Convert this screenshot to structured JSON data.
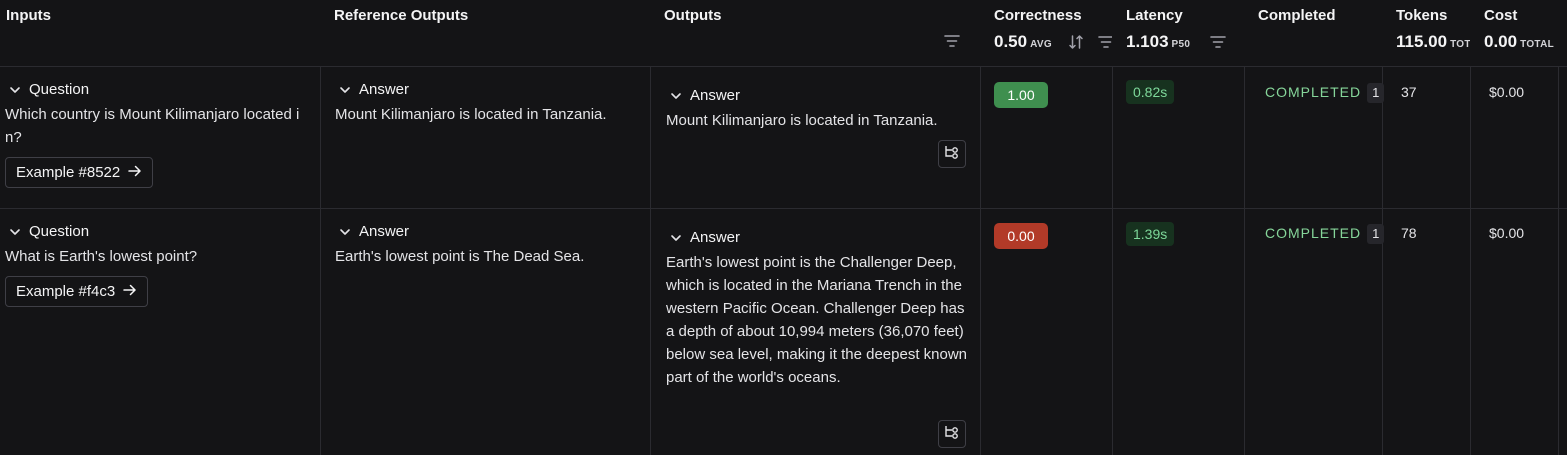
{
  "columns": {
    "inputs": "Inputs",
    "reference_outputs": "Reference Outputs",
    "outputs": "Outputs",
    "correctness": {
      "title": "Correctness",
      "value": "0.50",
      "unit": "AVG"
    },
    "latency": {
      "title": "Latency",
      "value": "1.103",
      "unit": "P50"
    },
    "completed": "Completed",
    "tokens": {
      "title": "Tokens",
      "value": "115.00",
      "unit": "TOTAL"
    },
    "cost": {
      "title": "Cost",
      "value": "0.00",
      "unit": "TOTAL"
    }
  },
  "rows": [
    {
      "input_label": "Question",
      "input_text": "Which country is Mount Kilimanjaro located in?",
      "example": "Example #8522",
      "reference_label": "Answer",
      "reference_text": "Mount Kilimanjaro is located in Tanzania.",
      "output_label": "Answer",
      "output_text": "Mount Kilimanjaro is located in Tanzania.",
      "correctness": "1.00",
      "latency": "0.82s",
      "status": "COMPLETED",
      "status_count": "1",
      "tokens": "37",
      "cost": "$0.00"
    },
    {
      "input_label": "Question",
      "input_text": "What is Earth's lowest point?",
      "example": "Example #f4c3",
      "reference_label": "Answer",
      "reference_text": "Earth's lowest point is The Dead Sea.",
      "output_label": "Answer",
      "output_text": "Earth's lowest point is the Challenger Deep, which is located in the Mariana Trench in the western Pacific Ocean. Challenger Deep has a depth of about 10,994 meters (36,070 feet) below sea level, making it the deepest known part of the world's oceans.",
      "correctness": "0.00",
      "latency": "1.39s",
      "status": "COMPLETED",
      "status_count": "1",
      "tokens": "78",
      "cost": "$0.00"
    }
  ],
  "colors": {
    "background": "#141416",
    "score_good": "#3f8f4f",
    "score_bad": "#b23a28",
    "latency_bg": "#17321f",
    "latency_text": "#7ed89a",
    "status_text": "#86d69a"
  },
  "icons": [
    "chevron-down-icon",
    "arrow-right-icon",
    "filter-icon",
    "sort-icon",
    "trace-icon"
  ]
}
